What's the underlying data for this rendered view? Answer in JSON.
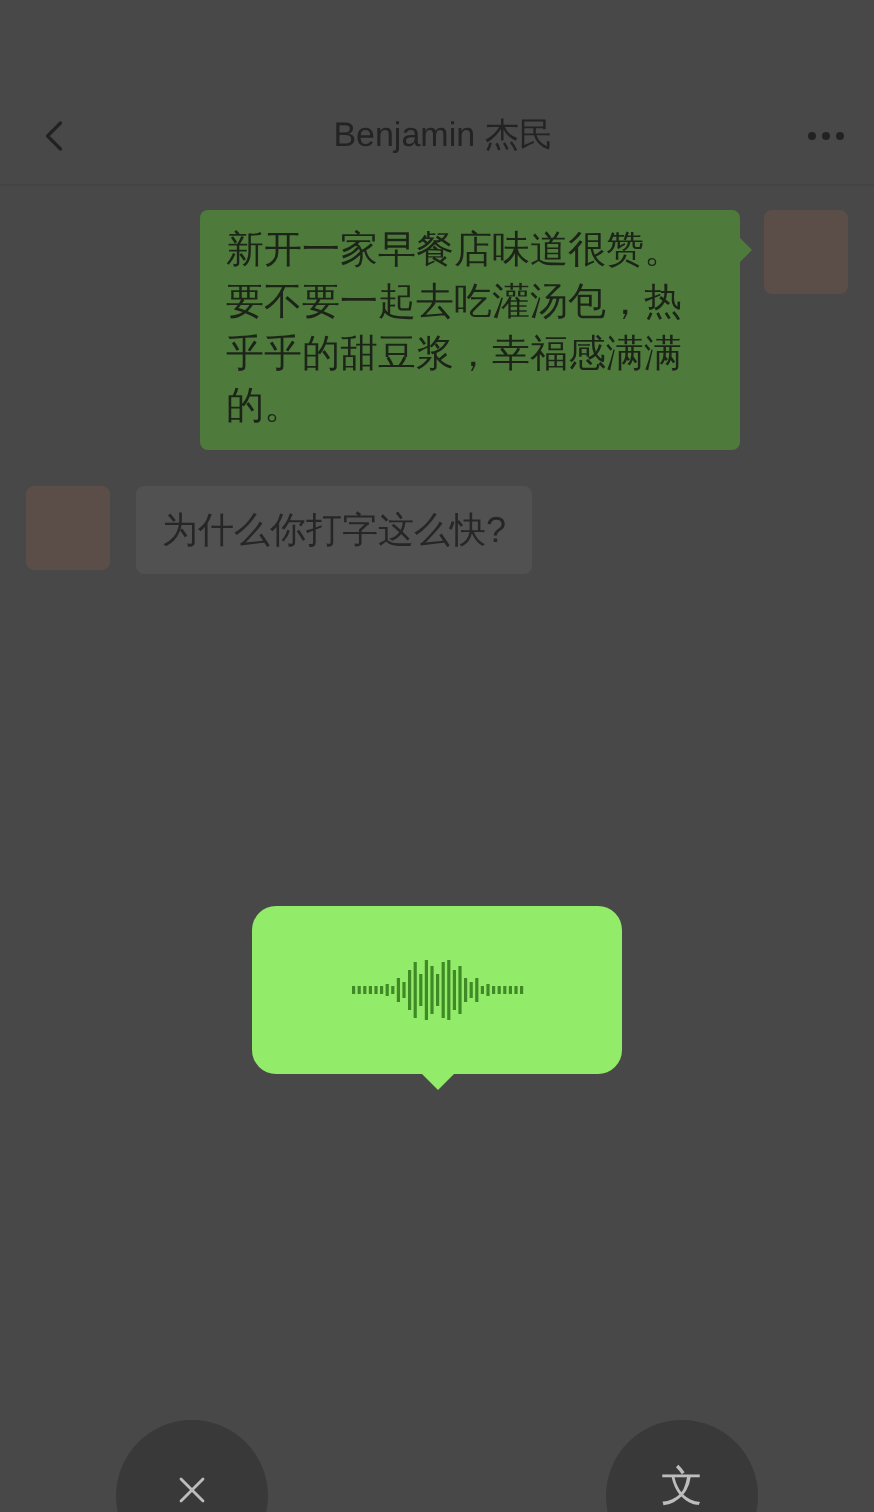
{
  "header": {
    "title": "Benjamin 杰民"
  },
  "messages": [
    {
      "kind": "sent",
      "text": "新开一家早餐店味道很赞。要不要一起去吃灌汤包，热乎乎的甜豆浆，幸福感满满的。"
    },
    {
      "kind": "received",
      "text": "为什么你打字这么快?"
    }
  ],
  "convert_button": {
    "label": "文"
  }
}
